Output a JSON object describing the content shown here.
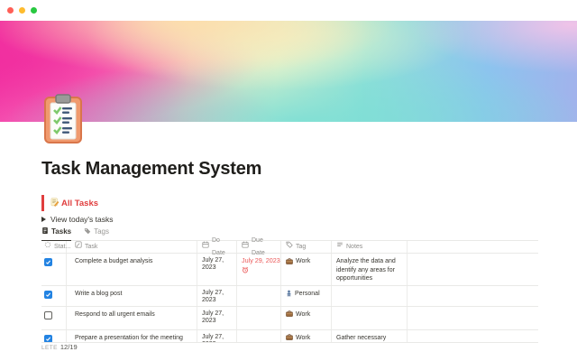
{
  "window": {
    "traffic_lights": [
      {
        "name": "close",
        "color": "#ff5f57"
      },
      {
        "name": "minimize",
        "color": "#febc2e"
      },
      {
        "name": "zoom",
        "color": "#28c840"
      }
    ]
  },
  "page": {
    "icon": "clipboard-emoji",
    "title": "Task Management System",
    "callout": {
      "icon": "memo-emoji",
      "text": "All Tasks",
      "color": "#e03e3e"
    },
    "toggle": {
      "label": "View today's tasks"
    },
    "tabs": [
      {
        "label": "Tasks",
        "icon": "document-icon",
        "active": true
      },
      {
        "label": "Tags",
        "icon": "tag-icon",
        "active": false
      }
    ]
  },
  "table": {
    "columns": [
      {
        "label": "Stat...",
        "icon": "status-icon"
      },
      {
        "label": "Task",
        "icon": "pencil-square-icon"
      },
      {
        "label": "Do Date",
        "icon": "calendar-icon"
      },
      {
        "label": "Due Date",
        "icon": "calendar-icon"
      },
      {
        "label": "Tag",
        "icon": "tag-icon"
      },
      {
        "label": "Notes",
        "icon": "text-lines-icon"
      }
    ],
    "rows": [
      {
        "checked": true,
        "task": "Complete a budget analysis",
        "do_date": "July 27, 2023",
        "due_date": "July 29, 2023",
        "due_overdue": true,
        "tag": {
          "icon": "briefcase-emoji",
          "label": "Work"
        },
        "notes": "Analyze the data and identify any areas for opportunities"
      },
      {
        "checked": true,
        "task": "Write a blog post",
        "do_date": "July 27, 2023",
        "due_date": "",
        "tag": {
          "icon": "person-emoji",
          "label": "Personal"
        },
        "notes": ""
      },
      {
        "checked": false,
        "task": "Respond to all urgent emails",
        "do_date": "July 27, 2023",
        "due_date": "",
        "tag": {
          "icon": "briefcase-emoji",
          "label": "Work"
        },
        "notes": ""
      },
      {
        "checked": true,
        "task": "Prepare a presentation for the meeting",
        "do_date": "July 27, 2023",
        "due_date": "",
        "tag": {
          "icon": "briefcase-emoji",
          "label": "Work"
        },
        "notes": "Gather necessary"
      }
    ],
    "footer": {
      "calc_label": "LETE",
      "calc_value": "12/19"
    }
  },
  "colors": {
    "accent_blue": "#2383e2",
    "overdue_red": "#eb5757",
    "callout_red": "#e03e3e",
    "border": "#e9e9e7",
    "header_text": "#8f8e8b"
  }
}
